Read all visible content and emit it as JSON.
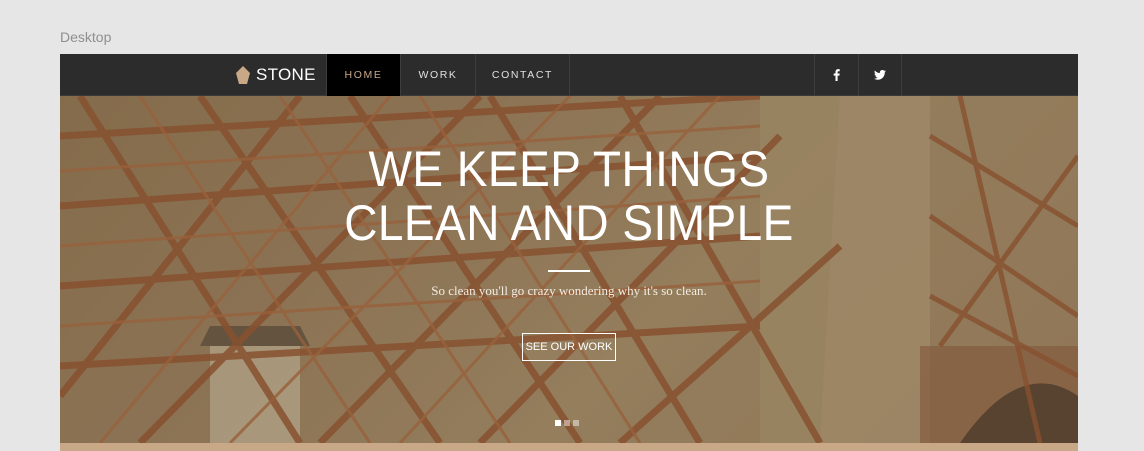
{
  "artboard": {
    "label": "Desktop"
  },
  "logo": {
    "text": "STONE",
    "icon": "diamond-icon",
    "color": "#c9a888"
  },
  "nav": {
    "items": [
      {
        "label": "HOME",
        "active": true
      },
      {
        "label": "WORK",
        "active": false
      },
      {
        "label": "CONTACT",
        "active": false
      }
    ]
  },
  "social": [
    {
      "icon": "facebook-icon"
    },
    {
      "icon": "twitter-icon"
    }
  ],
  "hero": {
    "headline_line1": "WE KEEP THINGS",
    "headline_line2": "CLEAN AND SIMPLE",
    "tagline": "So clean you'll go crazy wondering why it's so clean.",
    "cta_label": "SEE OUR WORK",
    "slides": {
      "count": 3,
      "active_index": 0
    }
  },
  "colors": {
    "nav_bg": "#2c2c2c",
    "accent": "#c9a888",
    "canvas_bg": "#e6e6e6"
  }
}
